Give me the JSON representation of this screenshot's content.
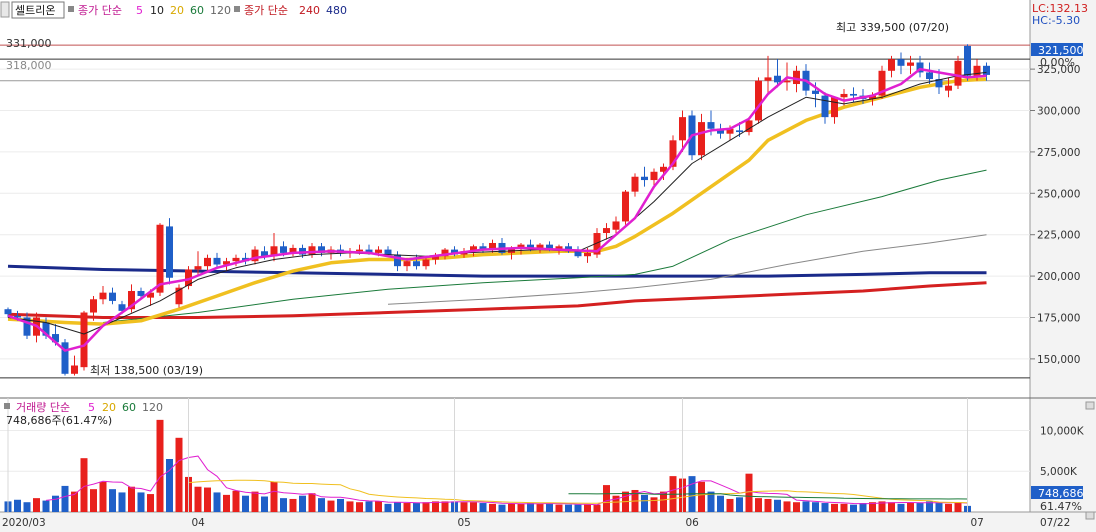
{
  "header": {
    "stock_name": "셀트리온",
    "ma_label": "종가 단순",
    "ma_periods": [
      "5",
      "10",
      "20",
      "60",
      "120"
    ],
    "ma_label2": "종가 단순",
    "ma_periods2": [
      "240",
      "480"
    ],
    "lc": "LC:132.13",
    "hc": "HC:-5.30"
  },
  "price_panel": {
    "high_label": "최고 339,500 (07/20)",
    "low_label": "최저 138,500 (03/19)",
    "line_331": "331,000",
    "line_318": "318,000",
    "current_price": "321,500",
    "current_pct": "0.00%"
  },
  "volume_panel": {
    "label": "거래량 단순",
    "ma_periods": [
      "5",
      "20",
      "60",
      "120"
    ],
    "volume_text": "748,686주(61.47%)",
    "current_volume": "748,686",
    "current_pct": "61.47%"
  },
  "colors": {
    "up": "#e8201c",
    "down": "#1f5fc8",
    "ma5": "#e020d0",
    "ma10": "#222222",
    "ma20": "#f0c020",
    "ma60": "#1a7a3a",
    "ma120": "#888888",
    "ma240": "#d42020",
    "ma480": "#1a2a8a",
    "price_tag": "#1f5fc8"
  },
  "chart_data": {
    "type": "candlestick",
    "ohlc_columns": [
      "open",
      "high",
      "low",
      "close"
    ],
    "price_axis": {
      "ylim": [
        130000,
        345000
      ],
      "ticks": [
        "150,000",
        "175,000",
        "200,000",
        "225,000",
        "250,000",
        "275,000",
        "300,000",
        "325,000"
      ]
    },
    "volume_axis": {
      "ylim": [
        0,
        13000
      ],
      "ticks": [
        "5,000K",
        "10,000K"
      ]
    },
    "x_labels": [
      {
        "label": "2020/03",
        "index": 0
      },
      {
        "label": "04",
        "index": 19
      },
      {
        "label": "05",
        "index": 47
      },
      {
        "label": "06",
        "index": 71
      },
      {
        "label": "07",
        "index": 101
      },
      {
        "label": "07/22",
        "index": 122
      }
    ],
    "candles": [
      [
        180000,
        181000,
        175000,
        177000
      ],
      [
        176000,
        179000,
        173000,
        175000
      ],
      [
        175000,
        178000,
        162000,
        164000
      ],
      [
        164000,
        178000,
        160000,
        175000
      ],
      [
        172000,
        175000,
        162000,
        164000
      ],
      [
        165000,
        171000,
        158000,
        160000
      ],
      [
        160000,
        162000,
        140000,
        141000
      ],
      [
        141000,
        152000,
        140000,
        146000
      ],
      [
        145000,
        179000,
        143000,
        178000
      ],
      [
        178000,
        188000,
        173000,
        186000
      ],
      [
        186000,
        194000,
        183000,
        190000
      ],
      [
        190000,
        193000,
        183000,
        185000
      ],
      [
        183000,
        185000,
        177000,
        179000
      ],
      [
        180000,
        195000,
        178000,
        191000
      ],
      [
        191000,
        193000,
        186000,
        188000
      ],
      [
        187000,
        192000,
        182000,
        190000
      ],
      [
        190000,
        232000,
        188000,
        231000
      ],
      [
        230000,
        235000,
        195000,
        199000
      ],
      [
        183000,
        195000,
        181000,
        193000
      ],
      [
        194000,
        206000,
        192000,
        204000
      ],
      [
        204000,
        215000,
        200000,
        206000
      ],
      [
        206000,
        213000,
        202000,
        211000
      ],
      [
        211000,
        214000,
        205000,
        207000
      ],
      [
        207000,
        211000,
        203000,
        209000
      ],
      [
        209000,
        213000,
        206000,
        211000
      ],
      [
        211000,
        214000,
        207000,
        209000
      ],
      [
        209000,
        218000,
        207000,
        216000
      ],
      [
        215000,
        218000,
        210000,
        212000
      ],
      [
        212000,
        226000,
        209000,
        218000
      ],
      [
        218000,
        221000,
        212000,
        214000
      ],
      [
        214000,
        219000,
        212000,
        217000
      ],
      [
        217000,
        219000,
        211000,
        213000
      ],
      [
        213000,
        220000,
        211000,
        218000
      ],
      [
        218000,
        220000,
        212000,
        214000
      ],
      [
        214000,
        218000,
        210000,
        216000
      ],
      [
        216000,
        219000,
        212000,
        214000
      ],
      [
        214000,
        217000,
        211000,
        215000
      ],
      [
        215000,
        219000,
        213000,
        216000
      ],
      [
        216000,
        219000,
        213000,
        214000
      ],
      [
        214000,
        218000,
        212000,
        216000
      ],
      [
        216000,
        218000,
        212000,
        213000
      ],
      [
        213000,
        215000,
        203000,
        206000
      ],
      [
        206000,
        211000,
        203000,
        209000
      ],
      [
        209000,
        213000,
        204000,
        206000
      ],
      [
        206000,
        212000,
        204000,
        210000
      ],
      [
        210000,
        214000,
        207000,
        212000
      ],
      [
        212000,
        217000,
        210000,
        216000
      ],
      [
        216000,
        218000,
        212000,
        213000
      ],
      [
        213000,
        217000,
        211000,
        215000
      ],
      [
        215000,
        219000,
        212000,
        218000
      ],
      [
        218000,
        220000,
        214000,
        216000
      ],
      [
        216000,
        222000,
        214000,
        220000
      ],
      [
        220000,
        223000,
        213000,
        214000
      ],
      [
        214000,
        218000,
        210000,
        217000
      ],
      [
        217000,
        220000,
        213000,
        219000
      ],
      [
        219000,
        222000,
        215000,
        217000
      ],
      [
        217000,
        220000,
        214000,
        219000
      ],
      [
        219000,
        221000,
        215000,
        216000
      ],
      [
        216000,
        219000,
        213000,
        218000
      ],
      [
        218000,
        220000,
        214000,
        215000
      ],
      [
        215000,
        218000,
        211000,
        212000
      ],
      [
        212000,
        217000,
        208000,
        214000
      ],
      [
        213000,
        229000,
        211000,
        226000
      ],
      [
        226000,
        232000,
        222000,
        229000
      ],
      [
        228000,
        236000,
        226000,
        233000
      ],
      [
        233000,
        252000,
        231000,
        251000
      ],
      [
        251000,
        262000,
        248000,
        260000
      ],
      [
        260000,
        266000,
        254000,
        258000
      ],
      [
        258000,
        265000,
        255000,
        263000
      ],
      [
        263000,
        268000,
        258000,
        266000
      ],
      [
        266000,
        285000,
        264000,
        282000
      ],
      [
        282000,
        300000,
        275000,
        296000
      ],
      [
        297000,
        300000,
        270000,
        273000
      ],
      [
        273000,
        298000,
        270000,
        293000
      ],
      [
        293000,
        300000,
        285000,
        289000
      ],
      [
        289000,
        292000,
        283000,
        286000
      ],
      [
        286000,
        291000,
        282000,
        289000
      ],
      [
        288000,
        293000,
        284000,
        287000
      ],
      [
        287000,
        296000,
        285000,
        294000
      ],
      [
        294000,
        320000,
        292000,
        318000
      ],
      [
        318000,
        333000,
        310000,
        320000
      ],
      [
        321000,
        331000,
        314000,
        317000
      ],
      [
        317000,
        329000,
        312000,
        318000
      ],
      [
        316000,
        327000,
        311000,
        324000
      ],
      [
        324000,
        328000,
        309000,
        312000
      ],
      [
        312000,
        317000,
        302000,
        310000
      ],
      [
        309000,
        311000,
        292000,
        296000
      ],
      [
        296000,
        303000,
        292000,
        308000
      ],
      [
        308000,
        313000,
        303000,
        310000
      ],
      [
        310000,
        314000,
        305000,
        309000
      ],
      [
        309000,
        313000,
        304000,
        307000
      ],
      [
        307000,
        311000,
        303000,
        309000
      ],
      [
        309000,
        327000,
        307000,
        324000
      ],
      [
        324000,
        333000,
        320000,
        331000
      ],
      [
        331000,
        335000,
        322000,
        327000
      ],
      [
        327000,
        333000,
        322000,
        329000
      ],
      [
        329000,
        333000,
        320000,
        323000
      ],
      [
        323000,
        329000,
        316000,
        319000
      ],
      [
        319000,
        325000,
        310000,
        314000
      ],
      [
        312000,
        320000,
        308000,
        315000
      ],
      [
        315000,
        333000,
        313000,
        330000
      ],
      [
        339000,
        340000,
        318000,
        321000
      ],
      [
        321000,
        331000,
        318000,
        327000
      ],
      [
        327000,
        329000,
        318000,
        321500
      ]
    ],
    "volume": [
      1300,
      1500,
      1200,
      1700,
      1400,
      2000,
      3200,
      2500,
      6600,
      2800,
      3700,
      2800,
      2400,
      3100,
      2400,
      2200,
      11300,
      6500,
      9100,
      4300,
      3100,
      3000,
      2400,
      2100,
      2600,
      2000,
      2500,
      1900,
      3700,
      1700,
      1600,
      2000,
      2300,
      1700,
      1400,
      1600,
      1300,
      1200,
      1300,
      1300,
      1000,
      1200,
      1100,
      1100,
      1200,
      1300,
      1300,
      1300,
      1200,
      1200,
      1100,
      1000,
      900,
      1000,
      1000,
      1100,
      1000,
      1100,
      900,
      900,
      900,
      900,
      900,
      3300,
      2000,
      2500,
      2700,
      2100,
      1800,
      2500,
      4400,
      4100,
      4400,
      3700,
      2500,
      2000,
      1600,
      1800,
      4700,
      1700,
      1600,
      1500,
      1300,
      1200,
      1300,
      1200,
      1100,
      1000,
      1000,
      900,
      1100,
      1200,
      1300,
      1200,
      1000,
      1100,
      1100,
      1300,
      1200,
      1000,
      1200,
      750
    ],
    "ma_lines_price": {
      "ma5": [
        [
          0,
          176000
        ],
        [
          3,
          170000
        ],
        [
          6,
          155000
        ],
        [
          8,
          158000
        ],
        [
          10,
          170000
        ],
        [
          13,
          182000
        ],
        [
          16,
          195000
        ],
        [
          19,
          198000
        ],
        [
          22,
          205000
        ],
        [
          26,
          211000
        ],
        [
          30,
          214000
        ],
        [
          34,
          215000
        ],
        [
          38,
          214000
        ],
        [
          42,
          210000
        ],
        [
          46,
          213000
        ],
        [
          50,
          216000
        ],
        [
          54,
          217000
        ],
        [
          58,
          216000
        ],
        [
          62,
          215000
        ],
        [
          66,
          235000
        ],
        [
          68,
          254000
        ],
        [
          70,
          268000
        ],
        [
          72,
          285000
        ],
        [
          74,
          288000
        ],
        [
          76,
          289000
        ],
        [
          78,
          295000
        ],
        [
          80,
          310000
        ],
        [
          82,
          320000
        ],
        [
          84,
          318000
        ],
        [
          86,
          310000
        ],
        [
          88,
          306000
        ],
        [
          91,
          309000
        ],
        [
          94,
          316000
        ],
        [
          96,
          325000
        ],
        [
          99,
          322000
        ],
        [
          101,
          320000
        ],
        [
          103,
          321000
        ]
      ],
      "ma10": [
        [
          0,
          175000
        ],
        [
          4,
          172000
        ],
        [
          8,
          165000
        ],
        [
          12,
          175000
        ],
        [
          16,
          185000
        ],
        [
          20,
          198000
        ],
        [
          24,
          205000
        ],
        [
          28,
          210000
        ],
        [
          32,
          213000
        ],
        [
          36,
          214000
        ],
        [
          40,
          213000
        ],
        [
          44,
          212000
        ],
        [
          48,
          214000
        ],
        [
          52,
          215000
        ],
        [
          56,
          216000
        ],
        [
          60,
          215000
        ],
        [
          64,
          225000
        ],
        [
          68,
          245000
        ],
        [
          72,
          268000
        ],
        [
          76,
          282000
        ],
        [
          80,
          296000
        ],
        [
          84,
          308000
        ],
        [
          88,
          304000
        ],
        [
          92,
          308000
        ],
        [
          96,
          316000
        ],
        [
          100,
          321000
        ],
        [
          103,
          323000
        ]
      ],
      "ma20": [
        [
          0,
          174000
        ],
        [
          6,
          172000
        ],
        [
          10,
          171000
        ],
        [
          14,
          173000
        ],
        [
          18,
          180000
        ],
        [
          22,
          188000
        ],
        [
          26,
          196000
        ],
        [
          30,
          203000
        ],
        [
          34,
          208000
        ],
        [
          38,
          210000
        ],
        [
          42,
          210000
        ],
        [
          46,
          211000
        ],
        [
          50,
          213000
        ],
        [
          54,
          214000
        ],
        [
          58,
          215000
        ],
        [
          62,
          215000
        ],
        [
          64,
          218000
        ],
        [
          66,
          224000
        ],
        [
          70,
          238000
        ],
        [
          74,
          254000
        ],
        [
          78,
          270000
        ],
        [
          80,
          282000
        ],
        [
          84,
          294000
        ],
        [
          88,
          302000
        ],
        [
          92,
          308000
        ],
        [
          96,
          314000
        ],
        [
          100,
          318000
        ],
        [
          103,
          319000
        ]
      ],
      "ma60": [
        [
          10,
          172000
        ],
        [
          20,
          178000
        ],
        [
          30,
          186000
        ],
        [
          40,
          192000
        ],
        [
          50,
          196000
        ],
        [
          60,
          199000
        ],
        [
          66,
          201000
        ],
        [
          70,
          206000
        ],
        [
          76,
          222000
        ],
        [
          84,
          237000
        ],
        [
          92,
          248000
        ],
        [
          98,
          258000
        ],
        [
          103,
          264000
        ]
      ],
      "ma120": [
        [
          40,
          183000
        ],
        [
          50,
          186000
        ],
        [
          60,
          190000
        ],
        [
          66,
          193000
        ],
        [
          74,
          198000
        ],
        [
          82,
          207000
        ],
        [
          90,
          215000
        ],
        [
          97,
          220000
        ],
        [
          103,
          225000
        ]
      ],
      "ma240": [
        [
          0,
          177000
        ],
        [
          10,
          175000
        ],
        [
          20,
          175000
        ],
        [
          30,
          176000
        ],
        [
          40,
          178000
        ],
        [
          50,
          180000
        ],
        [
          60,
          182000
        ],
        [
          66,
          185000
        ],
        [
          74,
          187000
        ],
        [
          82,
          189000
        ],
        [
          90,
          191000
        ],
        [
          97,
          194000
        ],
        [
          103,
          196000
        ]
      ],
      "ma480": [
        [
          0,
          206000
        ],
        [
          10,
          204000
        ],
        [
          20,
          203000
        ],
        [
          30,
          202000
        ],
        [
          40,
          201000
        ],
        [
          50,
          200000
        ],
        [
          60,
          200000
        ],
        [
          70,
          200000
        ],
        [
          80,
          200000
        ],
        [
          90,
          201000
        ],
        [
          97,
          202000
        ],
        [
          103,
          202000
        ]
      ]
    }
  }
}
